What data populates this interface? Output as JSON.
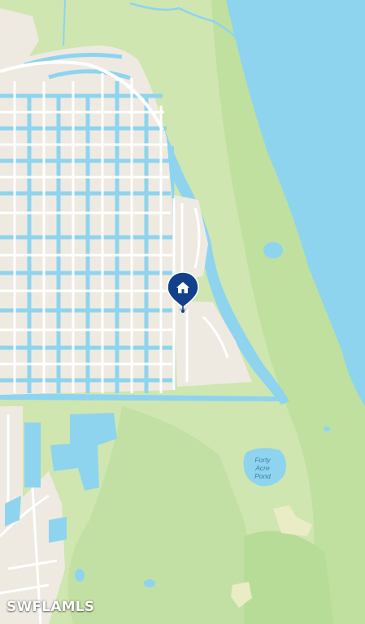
{
  "map": {
    "labels": {
      "pond_line1": "Forty",
      "pond_line2": "Acre",
      "pond_line3": "Pond"
    },
    "watermark": "SWFLAMLS",
    "marker_icon": "home-icon",
    "colors": {
      "water": "#8ed4ef",
      "land": "#cfe6b0",
      "park": "#b6dc96",
      "urban": "#eeeae2",
      "road": "#ffffff",
      "marker": "#12408a"
    }
  }
}
